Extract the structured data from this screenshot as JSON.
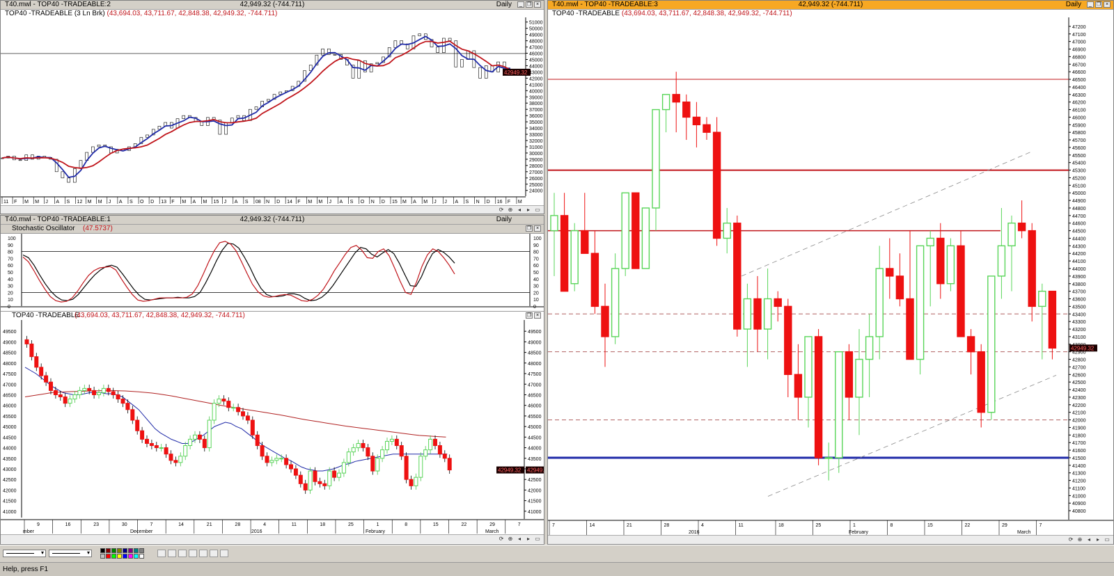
{
  "panes": {
    "left_top": {
      "title": "T40.mwl - TOP40 -TRADEABLE:2",
      "mid": "42,949.32 (-744.711)",
      "period": "Daily",
      "header_name": "TOP40 -TRADEABLE (3 Ln Brk)",
      "header_ohlc": "(43,694.03, 43,711.67, 42,848.38, 42,949.32, -744.711)",
      "price_tag": "42949.32"
    },
    "left_mid": {
      "title": "T40.mwl - TOP40 -TRADEABLE:1",
      "mid": "42,949.32 (-744.711)",
      "period": "Daily",
      "stoch_name": "Stochastic Oscillator",
      "stoch_val": "(47.5737)",
      "price_name": "TOP40 -TRADEABLE",
      "price_ohlc": "(43,694.03, 43,711.67, 42,848.38, 42,949.32, -744.711)",
      "price_tag": "42949.32"
    },
    "right": {
      "title": "T40.mwl - TOP40 -TRADEABLE:3",
      "mid": "42,949.32 (-744.711)",
      "period": "Daily",
      "header_name": "TOP40 -TRADEABLE",
      "header_ohlc": "(43,694.03, 43,711.67, 42,848.38, 42,949.32, -744.711)",
      "price_tag": "42949.32"
    }
  },
  "chart_data": [
    {
      "type": "line",
      "pane": "left_top",
      "y_ticks": [
        "51000",
        "50000",
        "49000",
        "48000",
        "47000",
        "46000",
        "45000",
        "44000",
        "43000",
        "42000",
        "41000",
        "40000",
        "39000",
        "38000",
        "37000",
        "36000",
        "35000",
        "34000",
        "33000",
        "32000",
        "31000",
        "30000",
        "29000",
        "28000",
        "27000",
        "26000",
        "25000",
        "24000"
      ],
      "ylim": [
        23300,
        51300
      ],
      "x_ticks": [
        "11",
        "F",
        "M",
        "M",
        "J",
        "A",
        "S",
        "12",
        "M",
        "M",
        "J",
        "A",
        "S",
        "O",
        "D",
        "13",
        "F",
        "M",
        "A",
        "M",
        "15",
        "J",
        "A",
        "S",
        "08",
        "N",
        "D",
        "14",
        "F",
        "M",
        "M",
        "J",
        "A",
        "S",
        "O",
        "N",
        "D",
        "15",
        "M",
        "A",
        "M",
        "J",
        "J",
        "A",
        "S",
        "N",
        "D",
        "16",
        "F",
        "M"
      ],
      "series": [
        {
          "color": "#000000",
          "values": [
            29200,
            29500,
            28900,
            28800,
            29700,
            29000,
            29500,
            29300,
            29000,
            27000,
            26000,
            25300,
            27500,
            28800,
            30100,
            31000,
            31300,
            31000,
            30000,
            30600,
            30400,
            31000,
            31500,
            32500,
            32900,
            33800,
            34300,
            34900,
            34000,
            35500,
            36000,
            35700,
            35000,
            34400,
            35700,
            35300,
            33000,
            34900,
            35600,
            36000,
            35200,
            37000,
            37400,
            38300,
            38600,
            39400,
            39800,
            40000,
            40700,
            41500,
            43200,
            44100,
            45700,
            46700,
            45800,
            45800,
            45000,
            44100,
            42000,
            44800,
            43000,
            44300,
            44500,
            45400,
            46900,
            48000,
            47500,
            46700,
            48800,
            49100,
            48200,
            47000,
            46100,
            48400,
            48000,
            43800,
            45000,
            46400,
            43700,
            42000,
            44000,
            43000,
            44600,
            43200,
            42949
          ]
        }
      ]
    },
    {
      "type": "line",
      "pane": "left_mid_stochastic",
      "y_ticks": [
        "100",
        "90",
        "80",
        "70",
        "60",
        "50",
        "40",
        "30",
        "20",
        "10",
        "0"
      ],
      "ylim": [
        0,
        100
      ],
      "reference_lines": [
        80,
        20
      ],
      "series": [
        {
          "color": "#000000",
          "values": [
            75,
            71,
            60,
            46,
            33,
            22,
            14,
            9,
            8,
            10,
            17,
            27,
            37,
            46,
            53,
            58,
            60,
            57,
            47,
            36,
            25,
            16,
            10,
            9,
            10,
            11,
            12,
            12,
            13,
            12,
            12,
            14,
            20,
            34,
            50,
            67,
            82,
            92,
            91,
            85,
            72,
            57,
            40,
            26,
            17,
            14,
            14,
            15,
            18,
            18,
            16,
            11,
            8,
            9,
            13,
            20,
            30,
            42,
            54,
            66,
            78,
            86,
            84,
            76,
            72,
            78,
            83,
            77,
            63,
            46,
            30,
            29,
            43,
            62,
            77,
            83,
            79,
            72,
            63
          ]
        },
        {
          "color": "#c0141a",
          "values": [
            72,
            65,
            52,
            38,
            25,
            14,
            8,
            6,
            7,
            12,
            22,
            34,
            45,
            52,
            56,
            57,
            58,
            53,
            40,
            28,
            17,
            9,
            7,
            8,
            10,
            12,
            12,
            12,
            12,
            12,
            13,
            18,
            30,
            47,
            65,
            81,
            93,
            95,
            91,
            81,
            65,
            48,
            32,
            21,
            15,
            13,
            14,
            16,
            17,
            16,
            12,
            8,
            7,
            10,
            16,
            25,
            38,
            52,
            64,
            76,
            86,
            89,
            82,
            71,
            70,
            80,
            84,
            74,
            56,
            37,
            20,
            17,
            35,
            58,
            75,
            84,
            80,
            71,
            60,
            47
          ]
        }
      ]
    },
    {
      "type": "candlestick",
      "pane": "left_mid_price",
      "y_ticks": [
        "49500",
        "49000",
        "48500",
        "48000",
        "47500",
        "47000",
        "46500",
        "46000",
        "45500",
        "45000",
        "44500",
        "44000",
        "43500",
        "43000",
        "42500",
        "42000",
        "41500",
        "41000"
      ],
      "ylim": [
        40700,
        49900
      ],
      "x_ticks": [
        "9",
        "16",
        "23",
        "30",
        "7",
        "14",
        "21",
        "28",
        "4",
        "11",
        "18",
        "25",
        "1",
        "8",
        "15",
        "22",
        "29",
        "7"
      ],
      "x_group_labels": [
        "mber",
        "December",
        "2016",
        "February",
        "March"
      ],
      "close": [
        48900,
        48300,
        47800,
        47400,
        47100,
        46700,
        46500,
        46400,
        46100,
        46300,
        46500,
        46700,
        46800,
        46700,
        46500,
        46600,
        46800,
        46650,
        46500,
        46300,
        46100,
        45800,
        45300,
        44800,
        44400,
        44200,
        44100,
        44000,
        44000,
        43700,
        43400,
        43300,
        43600,
        44100,
        44400,
        44600,
        44400,
        44000,
        45300,
        46100,
        46300,
        46200,
        45900,
        45900,
        45700,
        45500,
        45300,
        44600,
        44100,
        43600,
        43300,
        43400,
        43500,
        43500,
        43200,
        43000,
        42700,
        42300,
        42000,
        42900,
        42400,
        42300,
        42200,
        42900,
        42600,
        42800,
        43300,
        43800,
        44000,
        44200,
        44000,
        43600,
        42900,
        43500,
        43900,
        44300,
        44400,
        44100,
        43600,
        42500,
        42200,
        42600,
        43600,
        43900,
        44400,
        44100,
        43700,
        43500,
        42949
      ],
      "series": [
        {
          "name": "",
          "color": "#1f2aa8",
          "values": [
            47800,
            47650,
            47500,
            47300,
            47100,
            46900,
            46750,
            46600,
            46550,
            46500,
            46500,
            46550,
            46600,
            46600,
            46600,
            46550,
            46550,
            46500,
            46400,
            46200,
            46000,
            45800,
            45500,
            45200,
            44900,
            44700,
            44550,
            44400,
            44300,
            44200,
            44200,
            44300,
            44450,
            44600,
            44800,
            45000,
            45100,
            45200,
            45150,
            45000,
            44900,
            44700,
            44500,
            44300,
            44100,
            43950,
            43800,
            43650,
            43500,
            43400,
            43250,
            43100,
            43000,
            42950,
            42900,
            42900,
            42950,
            43000,
            43100,
            43200,
            43250,
            43350,
            43400,
            43450,
            43500,
            43550,
            43600,
            43650,
            43700,
            43700,
            43700,
            43700,
            43700,
            43700,
            43700,
            43700,
            43700,
            43700,
            43700
          ]
        },
        {
          "name": "",
          "color": "#b02020",
          "values": [
            46400,
            46450,
            46500,
            46550,
            46600,
            46620,
            46640,
            46650,
            46660,
            46670,
            46680,
            46690,
            46700,
            46700,
            46690,
            46680,
            46660,
            46640,
            46610,
            46580,
            46540,
            46490,
            46440,
            46380,
            46320,
            46260,
            46200,
            46140,
            46080,
            46020,
            45960,
            45910,
            45860,
            45810,
            45760,
            45710,
            45660,
            45610,
            45560,
            45500,
            45440,
            45380,
            45320,
            45270,
            45220,
            45170,
            45120,
            45070,
            45020,
            44980,
            44940,
            44900,
            44860,
            44820,
            44780,
            44740,
            44700,
            44660,
            44620,
            44580,
            44560,
            44540,
            44520,
            44500
          ]
        }
      ]
    },
    {
      "type": "candlestick",
      "pane": "right",
      "y_ticks": [
        "47200",
        "47100",
        "47000",
        "46900",
        "46800",
        "46700",
        "46600",
        "46500",
        "46400",
        "46300",
        "46200",
        "46100",
        "46000",
        "45900",
        "45800",
        "45700",
        "45600",
        "45500",
        "45400",
        "45300",
        "45200",
        "45100",
        "45000",
        "44900",
        "44800",
        "44700",
        "44600",
        "44500",
        "44400",
        "44300",
        "44200",
        "44100",
        "44000",
        "43900",
        "43800",
        "43700",
        "43600",
        "43500",
        "43400",
        "43300",
        "43200",
        "43100",
        "43000",
        "42900",
        "42800",
        "42700",
        "42600",
        "42500",
        "42400",
        "42300",
        "42200",
        "42100",
        "42000",
        "41900",
        "41800",
        "41700",
        "41600",
        "41500",
        "41400",
        "41300",
        "41200",
        "41100",
        "41000",
        "40900",
        "40800"
      ],
      "ylim": [
        40700,
        47300
      ],
      "x_ticks": [
        "7",
        "14",
        "21",
        "28",
        "4",
        "11",
        "18",
        "25",
        "1",
        "8",
        "15",
        "22",
        "29",
        "7"
      ],
      "x_group_labels": [
        "2016",
        "February",
        "March"
      ],
      "candles": [
        [
          44500,
          45000,
          43900,
          44700
        ],
        [
          44700,
          45000,
          43700,
          43700
        ],
        [
          43800,
          44600,
          43700,
          44500
        ],
        [
          44500,
          45000,
          44200,
          44200
        ],
        [
          44200,
          44500,
          43400,
          43500
        ],
        [
          43500,
          43800,
          42700,
          43100
        ],
        [
          43100,
          44200,
          43000,
          44000
        ],
        [
          44000,
          45000,
          43900,
          45000
        ],
        [
          45000,
          45000,
          44000,
          44000
        ],
        [
          44000,
          44700,
          44000,
          44800
        ],
        [
          44800,
          45900,
          44500,
          46100
        ],
        [
          46100,
          46300,
          45800,
          46300
        ],
        [
          46300,
          46600,
          45800,
          46200
        ],
        [
          46200,
          46300,
          45700,
          46000
        ],
        [
          46000,
          46200,
          45600,
          45900
        ],
        [
          45900,
          46000,
          45700,
          45800
        ],
        [
          45800,
          46000,
          44300,
          44400
        ],
        [
          44400,
          44800,
          44200,
          44600
        ],
        [
          44600,
          44700,
          43100,
          43200
        ],
        [
          43200,
          43800,
          42700,
          43600
        ],
        [
          43600,
          43900,
          42900,
          43200
        ],
        [
          43200,
          44000,
          42800,
          43600
        ],
        [
          43600,
          43700,
          43300,
          43500
        ],
        [
          43500,
          43600,
          42300,
          42600
        ],
        [
          42600,
          43000,
          42000,
          42300
        ],
        [
          42300,
          43000,
          41900,
          43100
        ],
        [
          43100,
          43200,
          41400,
          41500
        ],
        [
          41500,
          41700,
          41200,
          41500
        ],
        [
          41500,
          42900,
          41300,
          42900
        ],
        [
          42900,
          43000,
          42000,
          42300
        ],
        [
          42300,
          43200,
          41800,
          42800
        ],
        [
          42800,
          43400,
          42300,
          43100
        ],
        [
          43100,
          44300,
          42800,
          44000
        ],
        [
          44000,
          44400,
          43600,
          43900
        ],
        [
          43900,
          44200,
          43500,
          43600
        ],
        [
          43600,
          44500,
          42800,
          42800
        ],
        [
          42800,
          44100,
          42600,
          44300
        ],
        [
          44300,
          44500,
          43500,
          44400
        ],
        [
          44400,
          44600,
          43600,
          43800
        ],
        [
          43800,
          44400,
          43700,
          44300
        ],
        [
          44300,
          44500,
          43100,
          43100
        ],
        [
          43100,
          43200,
          42600,
          42900
        ],
        [
          42900,
          43000,
          41900,
          42100
        ],
        [
          42100,
          43400,
          42000,
          43900
        ],
        [
          43900,
          44800,
          43600,
          44300
        ],
        [
          44300,
          44700,
          43700,
          44600
        ],
        [
          44600,
          44900,
          44400,
          44500
        ],
        [
          44500,
          44600,
          43300,
          43500
        ],
        [
          43500,
          43800,
          42800,
          43700
        ],
        [
          43700,
          43700,
          42800,
          42949
        ]
      ],
      "levels": [
        {
          "value": 46500,
          "color": "#c0141a",
          "style": "solid",
          "width": 1
        },
        {
          "value": 45300,
          "color": "#c0141a",
          "style": "solid",
          "width": 2
        },
        {
          "value": 44500,
          "color": "#c0141a",
          "style": "solid",
          "width": 1.5
        },
        {
          "value": 43400,
          "color": "#b06060",
          "style": "dashed",
          "width": 1
        },
        {
          "value": 42900,
          "color": "#b06060",
          "style": "dashed",
          "width": 1
        },
        {
          "value": 42000,
          "color": "#b06060",
          "style": "dashed",
          "width": 1
        },
        {
          "value": 41500,
          "color": "#1f2aa8",
          "style": "solid",
          "width": 3
        }
      ]
    }
  ],
  "statusbar": {
    "left_text": "Help, press F1"
  },
  "colors": {
    "up": "#58d558",
    "down": "#ee1111",
    "active_title": "#f7a823"
  }
}
